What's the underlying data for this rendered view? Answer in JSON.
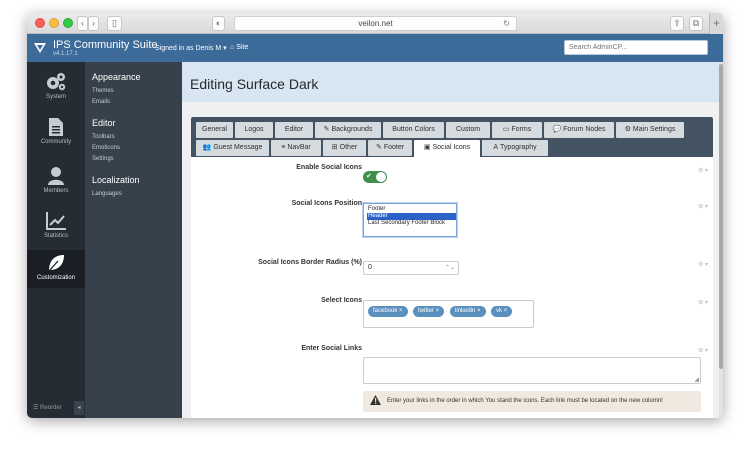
{
  "browser": {
    "url": "veilon.net",
    "reload_glyph": "↻",
    "share_glyph": "⇪",
    "tabs_glyph": "⧉",
    "newtab_glyph": "+"
  },
  "header": {
    "brand": "IPS Community Suite",
    "version": "v4.1.17.1",
    "signed_in": "Signed in as Denis M ▾",
    "site_link": "Site",
    "search_placeholder": "Search AdminCP..."
  },
  "sidebar": {
    "items": [
      {
        "label": "System",
        "icon": "gears-icon"
      },
      {
        "label": "Community",
        "icon": "document-icon"
      },
      {
        "label": "Members",
        "icon": "user-icon"
      },
      {
        "label": "Statistics",
        "icon": "chart-icon"
      },
      {
        "label": "Customization",
        "icon": "leaf-icon",
        "active": true
      }
    ],
    "reorder": "☰ Reorder",
    "collapse": "◂"
  },
  "submenu": {
    "sections": [
      {
        "title": "Appearance",
        "links": [
          "Themes",
          "Emails"
        ]
      },
      {
        "title": "Editor",
        "links": [
          "Toolbars",
          "Emoticons",
          "Settings"
        ]
      },
      {
        "title": "Localization",
        "links": [
          "Languages"
        ]
      }
    ]
  },
  "page": {
    "title": "Editing Surface Dark"
  },
  "tabs": {
    "row1": [
      {
        "label": "General"
      },
      {
        "label": "Logos"
      },
      {
        "label": "Editor"
      },
      {
        "label": "Backgrounds",
        "glyph": "✎"
      },
      {
        "label": "Button Colors"
      },
      {
        "label": "Custom"
      },
      {
        "label": "Forms",
        "glyph": "▭"
      },
      {
        "label": "Forum Nodes",
        "glyph": "💬"
      },
      {
        "label": "Main Settings",
        "glyph": "⚙"
      }
    ],
    "row2": [
      {
        "label": "Guest Message",
        "glyph": "👥"
      },
      {
        "label": "NavBar",
        "glyph": "≡"
      },
      {
        "label": "Other",
        "glyph": "⊞"
      },
      {
        "label": "Footer",
        "glyph": "✎"
      },
      {
        "label": "Social Icons",
        "glyph": "▣",
        "active": true
      },
      {
        "label": "Typography",
        "glyph": "A"
      }
    ]
  },
  "form": {
    "enable_social": {
      "label": "Enable Social Icons",
      "value": "on",
      "check": "✔"
    },
    "position": {
      "label": "Social Icons Position",
      "options": [
        "Footer",
        "Header",
        "Last Secondary Footer Block"
      ],
      "selected": "Header"
    },
    "radius": {
      "label": "Social Icons Border Radius (%)",
      "value": "0",
      "spin": "⌃⌄"
    },
    "select_icons": {
      "label": "Select Icons",
      "tags": [
        "facebook ×",
        "twitter ×",
        "linkedin ×",
        "vk ×"
      ]
    },
    "links": {
      "label": "Enter Social Links",
      "value": "",
      "grip": "◢"
    },
    "warning": "Enter your links in the order in which You stand the icons. Each link must be located on the new column!",
    "gear": "⚙ ▾"
  },
  "colors": {
    "topbar": "#3c6a99",
    "sidebar": "#262c33",
    "submenu": "#37414c",
    "tabbar": "#435362",
    "toggle_on": "#3f8f4b",
    "tag": "#5a8fbe"
  }
}
